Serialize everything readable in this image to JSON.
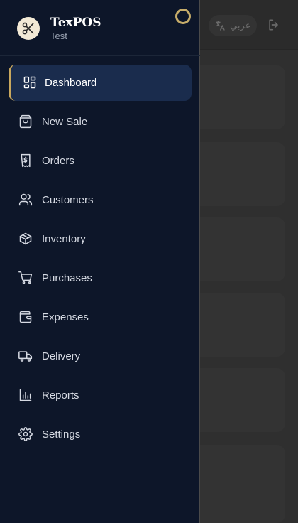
{
  "brand": {
    "name": "TexPOS",
    "subtitle": "Test"
  },
  "header": {
    "language_label": "عربي"
  },
  "menu": [
    {
      "label": "Dashboard",
      "icon": "dashboard-icon",
      "active": true
    },
    {
      "label": "New Sale",
      "icon": "shopping-bag-icon",
      "active": false
    },
    {
      "label": "Orders",
      "icon": "receipt-icon",
      "active": false
    },
    {
      "label": "Customers",
      "icon": "users-icon",
      "active": false
    },
    {
      "label": "Inventory",
      "icon": "box-icon",
      "active": false
    },
    {
      "label": "Purchases",
      "icon": "cart-icon",
      "active": false
    },
    {
      "label": "Expenses",
      "icon": "wallet-icon",
      "active": false
    },
    {
      "label": "Delivery",
      "icon": "truck-icon",
      "active": false
    },
    {
      "label": "Reports",
      "icon": "bar-chart-icon",
      "active": false
    },
    {
      "label": "Settings",
      "icon": "gear-icon",
      "active": false
    }
  ],
  "colors": {
    "drawer_bg": "#0d1629",
    "active_bg": "#1a2c4d",
    "accent_gold": "#c9a85e",
    "text": "#d6dae3"
  }
}
